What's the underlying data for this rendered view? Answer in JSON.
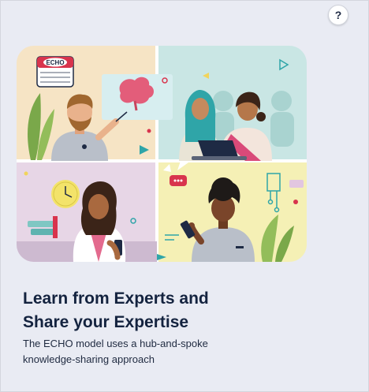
{
  "help_button": {
    "label": "?",
    "icon": "question-icon"
  },
  "illustration": {
    "calendar_label": "ECHO",
    "colors": {
      "panel_top_left": "#f6e4c5",
      "panel_top_right": "#c9e6e4",
      "panel_bottom_left": "#e7d6e6",
      "panel_bottom_right": "#f5f0b5",
      "accent_red": "#d8344d",
      "teal": "#2fa5a8"
    }
  },
  "headline": {
    "line1": "Learn from Experts and",
    "line2": "Share your Expertise"
  },
  "subtext": {
    "line1": "The ECHO model uses a hub-and-spoke",
    "line2": "knowledge-sharing approach"
  }
}
